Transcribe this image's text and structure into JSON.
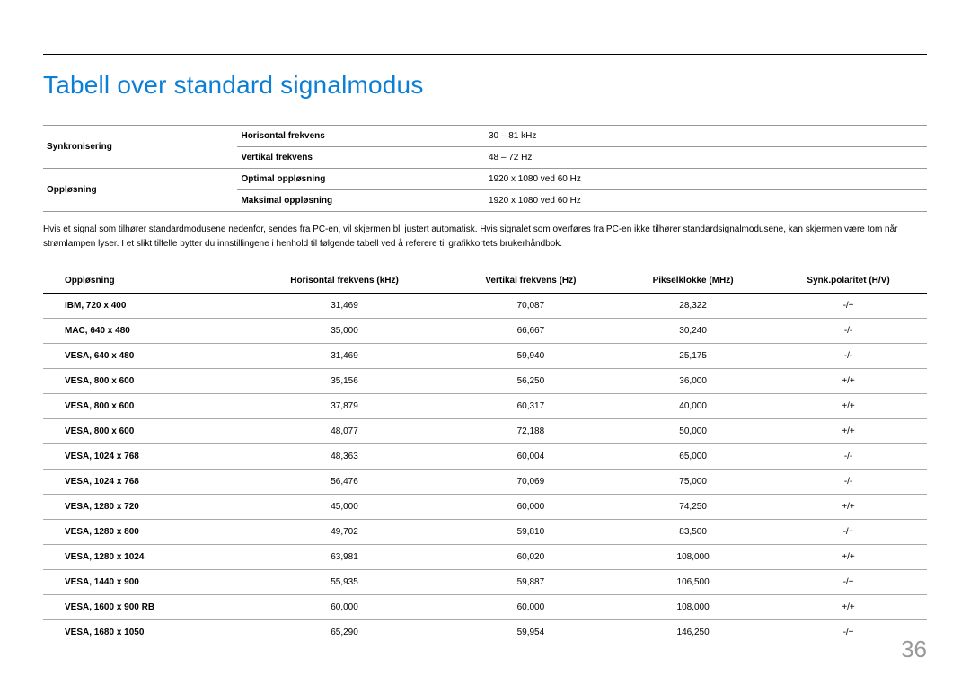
{
  "title": "Tabell over standard signalmodus",
  "spec": {
    "row1_label": "Synkronisering",
    "r1a_label": "Horisontal frekvens",
    "r1a_value": "30 – 81 kHz",
    "r1b_label": "Vertikal frekvens",
    "r1b_value": "48 – 72 Hz",
    "row2_label": "Oppløsning",
    "r2a_label": "Optimal oppløsning",
    "r2a_value": "1920 x 1080 ved 60 Hz",
    "r2b_label": "Maksimal oppløsning",
    "r2b_value": "1920 x 1080 ved 60 Hz"
  },
  "note": "Hvis et signal som tilhører standardmodusene nedenfor, sendes fra PC-en, vil skjermen bli justert automatisk. Hvis signalet som overføres fra PC-en ikke tilhører standardsignalmodusene, kan skjermen være tom når strømlampen lyser. I et slikt tilfelle bytter du innstillingene i henhold til følgende tabell ved å referere til grafikkortets brukerhåndbok.",
  "headers": {
    "c0": "Oppløsning",
    "c1": "Horisontal frekvens (kHz)",
    "c2": "Vertikal frekvens (Hz)",
    "c3": "Pikselklokke (MHz)",
    "c4": "Synk.polaritet (H/V)"
  },
  "rows": [
    {
      "c0": "IBM, 720 x 400",
      "c1": "31,469",
      "c2": "70,087",
      "c3": "28,322",
      "c4": "-/+"
    },
    {
      "c0": "MAC, 640 x 480",
      "c1": "35,000",
      "c2": "66,667",
      "c3": "30,240",
      "c4": "-/-"
    },
    {
      "c0": "VESA, 640 x 480",
      "c1": "31,469",
      "c2": "59,940",
      "c3": "25,175",
      "c4": "-/-"
    },
    {
      "c0": "VESA, 800 x 600",
      "c1": "35,156",
      "c2": "56,250",
      "c3": "36,000",
      "c4": "+/+"
    },
    {
      "c0": "VESA, 800 x 600",
      "c1": "37,879",
      "c2": "60,317",
      "c3": "40,000",
      "c4": "+/+"
    },
    {
      "c0": "VESA, 800 x 600",
      "c1": "48,077",
      "c2": "72,188",
      "c3": "50,000",
      "c4": "+/+"
    },
    {
      "c0": "VESA, 1024 x 768",
      "c1": "48,363",
      "c2": "60,004",
      "c3": "65,000",
      "c4": "-/-"
    },
    {
      "c0": "VESA, 1024 x 768",
      "c1": "56,476",
      "c2": "70,069",
      "c3": "75,000",
      "c4": "-/-"
    },
    {
      "c0": "VESA, 1280 x 720",
      "c1": "45,000",
      "c2": "60,000",
      "c3": "74,250",
      "c4": "+/+"
    },
    {
      "c0": "VESA, 1280 x 800",
      "c1": "49,702",
      "c2": "59,810",
      "c3": "83,500",
      "c4": "-/+"
    },
    {
      "c0": "VESA, 1280 x 1024",
      "c1": "63,981",
      "c2": "60,020",
      "c3": "108,000",
      "c4": "+/+"
    },
    {
      "c0": "VESA, 1440 x 900",
      "c1": "55,935",
      "c2": "59,887",
      "c3": "106,500",
      "c4": "-/+"
    },
    {
      "c0": "VESA, 1600 x 900 RB",
      "c1": "60,000",
      "c2": "60,000",
      "c3": "108,000",
      "c4": "+/+"
    },
    {
      "c0": "VESA, 1680 x 1050",
      "c1": "65,290",
      "c2": "59,954",
      "c3": "146,250",
      "c4": "-/+"
    }
  ],
  "page": "36"
}
